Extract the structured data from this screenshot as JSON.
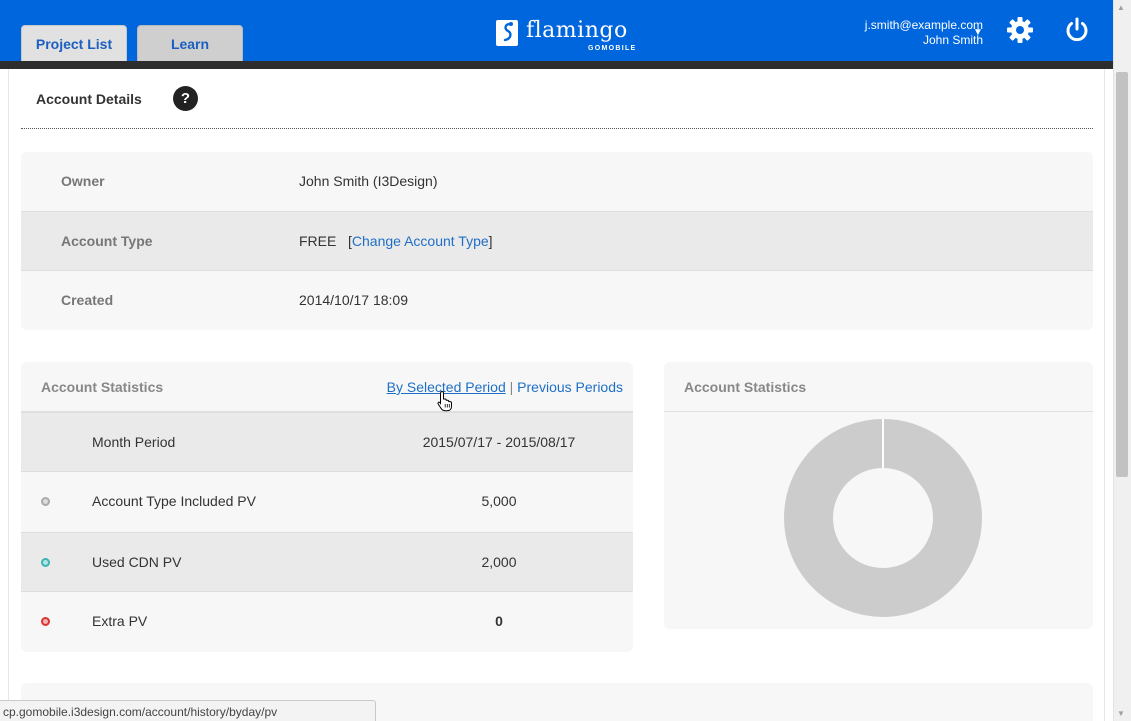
{
  "header": {
    "tabs": [
      {
        "label": "Project List"
      },
      {
        "label": "Learn"
      }
    ],
    "logo": {
      "name": "flamingo",
      "sub": "GOMOBILE"
    },
    "user": {
      "email": "j.smith@example.com",
      "name": "John Smith"
    },
    "icons": [
      "flamingo-logo-icon",
      "chevron-down-icon",
      "gear-icon",
      "power-icon"
    ],
    "accent_color": "#0066dd"
  },
  "page": {
    "title": "Account Details",
    "help_symbol": "?"
  },
  "details": {
    "rows": [
      {
        "label": "Owner",
        "value": "John Smith (I3Design)"
      },
      {
        "label": "Account Type",
        "value": "FREE",
        "link_open": "[",
        "link": "Change Account Type",
        "link_close": "]"
      },
      {
        "label": "Created",
        "value": "2014/10/17 18:09"
      }
    ]
  },
  "statistics": {
    "title": "Account Statistics",
    "links": {
      "selected": "By Selected Period",
      "separator": "|",
      "previous": "Previous Periods"
    },
    "rows": [
      {
        "label": "Month Period",
        "value": "2015/07/17 - 2015/08/17"
      },
      {
        "label": "Account Type Included PV",
        "value": "5,000",
        "bullet_color": "#aaaaaa"
      },
      {
        "label": "Used CDN PV",
        "value": "2,000",
        "bullet_color": "#3bb3b3"
      },
      {
        "label": "Extra PV",
        "value": "0",
        "bullet_color": "#dd3333"
      }
    ]
  },
  "chart": {
    "title": "Account Statistics"
  },
  "chart_data": {
    "type": "pie",
    "donut": true,
    "categories": [
      "Account Type Included PV"
    ],
    "values": [
      5000
    ],
    "colors": [
      "#cccccc"
    ],
    "title": ""
  },
  "status_bar": {
    "url": "cp.gomobile.i3design.com/account/history/byday/pv"
  }
}
